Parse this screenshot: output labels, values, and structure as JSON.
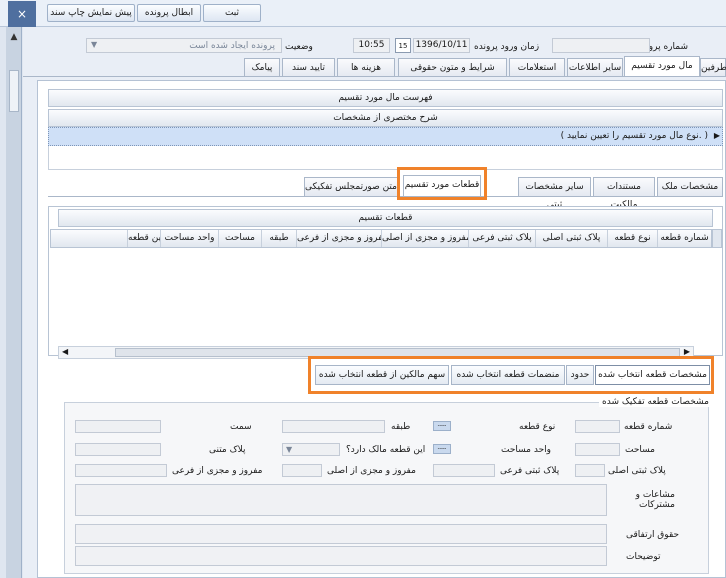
{
  "toolbar": {
    "close": "×",
    "print_preview": "پیش نمایش چاپ سند",
    "cancel_case": "ابطال پرونده",
    "register": "ثبت"
  },
  "header": {
    "case_number_label": "شماره پرونده",
    "case_number_value": "",
    "entry_time_label": "زمان ورود پرونده",
    "entry_date": "1396/10/11",
    "calendar_day": "15",
    "entry_time": "10:55",
    "status_label": "وضعیت",
    "status_value": "پرونده ایجاد شده است"
  },
  "main_tabs": [
    "طرفین",
    "مال مورد تقسیم",
    "سایر اطلاعات",
    "استعلامات",
    "شرایط و متون حقوقی",
    "هزینه ها",
    "تایید سند",
    "پیامک"
  ],
  "property_list": {
    "title": "فهرست مال مورد تقسیم",
    "column": "شرح مختصری از مشخصات",
    "row": "( نوع مال مورد تقسیم را تعیین نمایید. )"
  },
  "sub_tabs": [
    "مشخصات ملک",
    "مستندات مالکیت",
    "سایر مشخصات ثبتی",
    "قطعات مورد تقسیم",
    "متن صورتمجلس تفکیکی"
  ],
  "parts_grid": {
    "title": "قطعات تقسیم",
    "columns": [
      "شماره قطعه",
      "نوع قطعه",
      "پلاک ثبتی اصلی",
      "پلاک ثبتی فرعی",
      "مفروز و مجزی از اصلی",
      "مفروز و مجزی از فرعی",
      "طبقه",
      "مساحت",
      "واحد مساحت",
      "آیا این قطعه"
    ]
  },
  "action_buttons": [
    "مشخصات قطعه انتخاب شده",
    "حدود",
    "منضمات قطعه انتخاب شده",
    "سهم مالکین از قطعه انتخاب شده"
  ],
  "detail": {
    "group_title": "مشخصات قطعه تفکیک شده",
    "part_number": "شماره قطعه",
    "part_type": "نوع قطعه",
    "floor": "طبقه",
    "direction": "سمت",
    "area": "مساحت",
    "area_unit": "واحد مساحت",
    "owner_question": "این قطعه مالک دارد؟",
    "plaque_text": "پلاک متنی",
    "main_plaque": "پلاک ثبتی اصلی",
    "sub_plaque": "پلاک ثبتی فرعی",
    "from_main": "مفروز و مجزی از اصلی",
    "from_sub": "مفروز و مجزی از فرعی",
    "shared": "مشاعات و مشترکات",
    "easement": "حقوق ارتفاقی",
    "notes": "توضیحات"
  },
  "colors": {
    "accent": "#f0822a",
    "selection": "#cfe0f7",
    "panel": "#e9eef6"
  }
}
